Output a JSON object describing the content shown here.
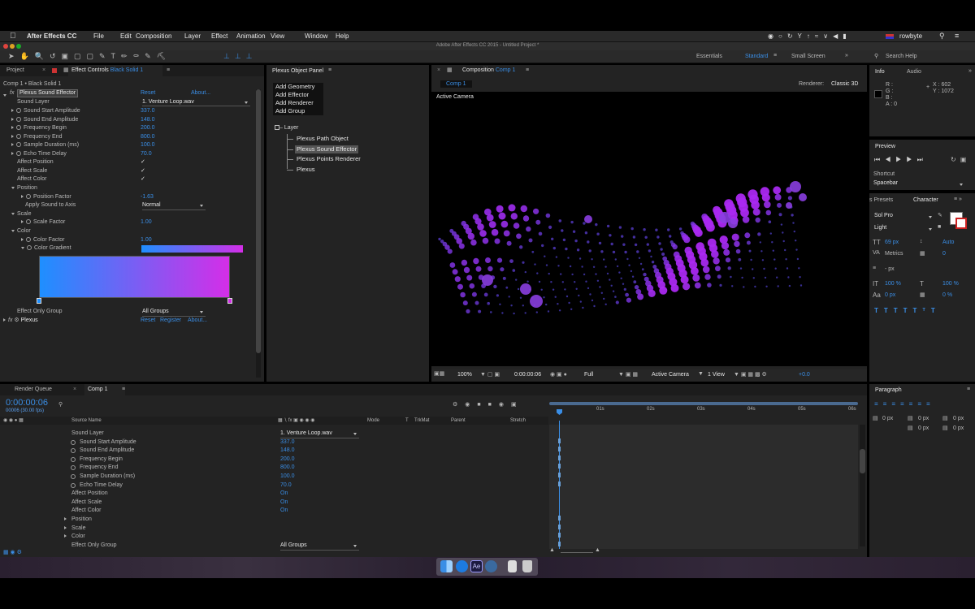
{
  "menubar": {
    "app": "After Effects CC",
    "items": [
      "File",
      "Edit",
      "Composition",
      "Layer",
      "Effect",
      "Animation",
      "View",
      "Window",
      "Help"
    ],
    "user": "rowbyte"
  },
  "window_title": "Adobe After Effects CC 2015 - Untitled Project *",
  "workspaces": {
    "essentials": "Essentials",
    "standard": "Standard",
    "small_screen": "Small Screen",
    "search_help": "Search Help"
  },
  "project_tabs": {
    "project": "Project",
    "effect_controls": "Effect Controls",
    "effect_layer": "Black Solid 1",
    "breadcrumb": "Comp 1 • Black Solid 1"
  },
  "effect_controls": {
    "effect_name": "Plexus Sound Effector",
    "reset": "Reset",
    "about": "About...",
    "sound_layer_label": "Sound Layer",
    "sound_layer_value": "1. Venture Loop.wav",
    "props": [
      {
        "label": "Sound Start Amplitude",
        "value": "337.0"
      },
      {
        "label": "Sound End Amplitude",
        "value": "148.0"
      },
      {
        "label": "Frequency Begin",
        "value": "200.0"
      },
      {
        "label": "Frequency End",
        "value": "800.0"
      },
      {
        "label": "Sample Duration (ms)",
        "value": "100.0"
      },
      {
        "label": "Echo Time Delay",
        "value": "70.0"
      }
    ],
    "affect_position": "Affect Position",
    "affect_scale": "Affect Scale",
    "affect_color": "Affect Color",
    "position_group": "Position",
    "position_factor_label": "Position Factor",
    "position_factor_value": "-1.63",
    "apply_sound_label": "Apply Sound to Axis",
    "apply_sound_value": "Normal",
    "scale_group": "Scale",
    "scale_factor_label": "Scale Factor",
    "scale_factor_value": "1.00",
    "color_group": "Color",
    "color_factor_label": "Color Factor",
    "color_factor_value": "1.00",
    "color_gradient_label": "Color Gradient",
    "effect_only_group_label": "Effect Only Group",
    "effect_only_group_value": "All Groups",
    "plexus_name": "Plexus",
    "register": "Register",
    "gradient_start": "#1e8fff",
    "gradient_end": "#d42ee8"
  },
  "plexus_panel": {
    "title": "Plexus Object Panel",
    "buttons": [
      "Add Geometry",
      "Add Effector",
      "Add Renderer",
      "Add Group"
    ],
    "tree_root": "Layer",
    "tree_items": [
      "Plexus Path Object",
      "Plexus Sound Effector",
      "Plexus Points Renderer",
      "Plexus"
    ]
  },
  "composition": {
    "tab_prefix": "Composition",
    "tab_name": "Comp 1",
    "comp_tab": "Comp 1",
    "renderer_label": "Renderer:",
    "renderer_value": "Classic 3D",
    "active_camera": "Active Camera",
    "footer": {
      "zoom": "100%",
      "timecode": "0:00:00:06",
      "resolution": "Full",
      "camera": "Active Camera",
      "views": "1 View",
      "exposure": "+0.0"
    }
  },
  "info": {
    "tab_info": "Info",
    "tab_audio": "Audio",
    "r": "R :",
    "g": "G :",
    "b": "B :",
    "a": "A : 0",
    "x": "X : 602",
    "y": "Y : 1072"
  },
  "preview": {
    "title": "Preview",
    "shortcut_label": "Shortcut",
    "shortcut_value": "Spacebar"
  },
  "character": {
    "tab_presets": "s Presets",
    "tab_character": "Character",
    "font": "Sol Pro",
    "style": "Light",
    "size": "69 px",
    "leading": "Auto",
    "kerning": "Metrics",
    "tracking": "0",
    "stroke": "- px",
    "vscale": "100 %",
    "hscale": "100 %",
    "baseline": "0 px",
    "tsume": "0 %"
  },
  "paragraph": {
    "title": "Paragraph",
    "v1": "0 px",
    "v2": "0 px",
    "v3": "0 px",
    "v4": "0 px",
    "v5": "0 px"
  },
  "timeline": {
    "tab_render": "Render Queue",
    "tab_comp": "Comp 1",
    "timecode": "0:00:00:06",
    "frames": "00006 (30.00 fps)",
    "columns": {
      "source": "Source Name",
      "mode": "Mode",
      "t": "T",
      "trkmat": "TrkMat",
      "parent": "Parent",
      "stretch": "Stretch"
    },
    "rows": [
      {
        "label": "Sound Layer",
        "value": "1. Venture Loop.wav",
        "dropdown": true
      },
      {
        "label": "Sound Start Amplitude",
        "value": "337.0",
        "stopwatch": true
      },
      {
        "label": "Sound End Amplitude",
        "value": "148.0",
        "stopwatch": true
      },
      {
        "label": "Frequency Begin",
        "value": "200.0",
        "stopwatch": true
      },
      {
        "label": "Frequency End",
        "value": "800.0",
        "stopwatch": true
      },
      {
        "label": "Sample Duration (ms)",
        "value": "100.0",
        "stopwatch": true
      },
      {
        "label": "Echo Time Delay",
        "value": "70.0",
        "stopwatch": true
      },
      {
        "label": "Affect Position",
        "value": "On"
      },
      {
        "label": "Affect Scale",
        "value": "On"
      },
      {
        "label": "Affect Color",
        "value": "On"
      },
      {
        "label": "Position",
        "value": "",
        "group": true
      },
      {
        "label": "Scale",
        "value": "",
        "group": true
      },
      {
        "label": "Color",
        "value": "",
        "group": true
      },
      {
        "label": "Effect Only Group",
        "value": "All Groups",
        "dropdown": true
      }
    ],
    "ruler": [
      "01s",
      "02s",
      "03s",
      "04s",
      "05s",
      "06s"
    ]
  }
}
